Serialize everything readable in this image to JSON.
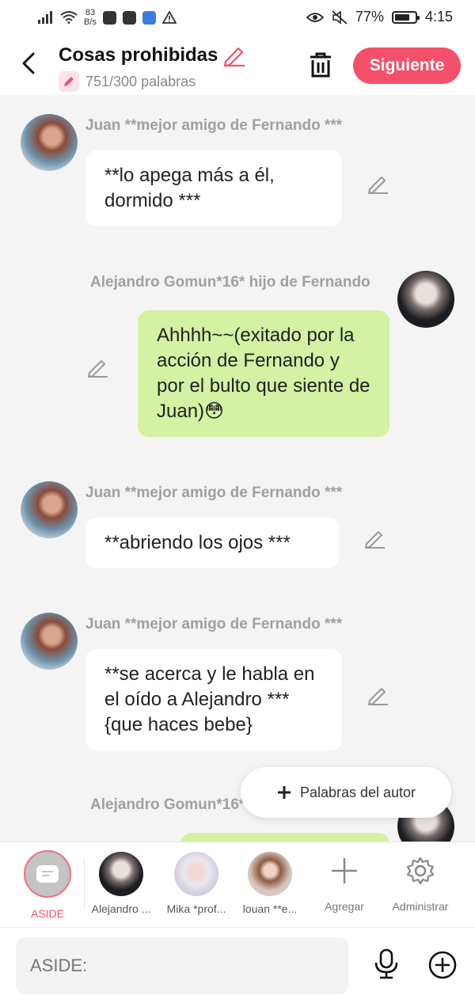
{
  "status_bar": {
    "net_speed_value": "83",
    "net_speed_unit": "B/s",
    "battery": "77%",
    "battery_level": 0.77,
    "time": "4:15"
  },
  "header": {
    "title": "Cosas prohibidas",
    "word_count": "751/300 palabras",
    "next_label": "Siguiente"
  },
  "messages": [
    {
      "speaker": "Juan **mejor amigo de Fernando ***",
      "text": "**lo  apega más a él, dormido ***",
      "side": "left"
    },
    {
      "speaker": "Alejandro Gomun*16* hijo de Fernando",
      "text": "Ahhhh~~(exitado por la acción de Fernando y por el bulto que siente de Juan)😳",
      "side": "right"
    },
    {
      "speaker": "Juan **mejor amigo de Fernando ***",
      "text": "**abriendo los ojos ***",
      "side": "left"
    },
    {
      "speaker": "Juan **mejor amigo de Fernando ***",
      "text": "**se acerca y le habla en el oído a Alejandro ***{que haces bebe}",
      "side": "left"
    },
    {
      "speaker": "Alejandro Gomun*16* hijo de Fernando",
      "text": "",
      "side": "right"
    }
  ],
  "author_words_button": "Palabras del autor",
  "characters": [
    {
      "label": "ASIDE",
      "active": true
    },
    {
      "label": "Alejandro ..."
    },
    {
      "label": "Mika *prof..."
    },
    {
      "label": "louan **e..."
    }
  ],
  "tools": {
    "add_label": "Agregar",
    "manage_label": "Administrar"
  },
  "input": {
    "placeholder": "ASIDE:"
  },
  "colors": {
    "accent": "#f4506a",
    "green_bubble": "#d4f1a4",
    "name_gray": "#a0a0a0"
  }
}
